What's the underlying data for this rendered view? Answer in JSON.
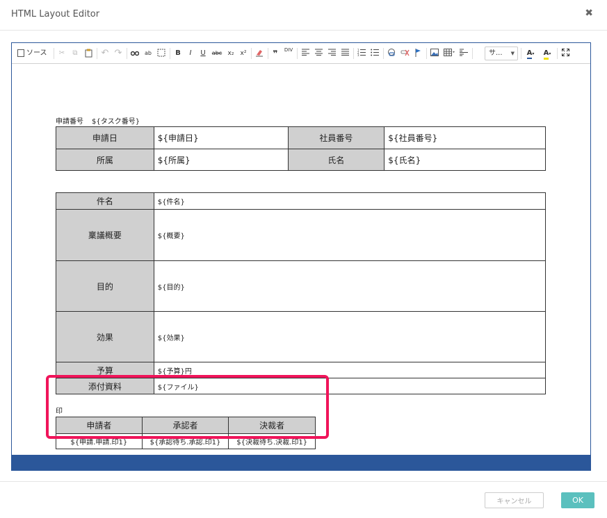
{
  "dialog": {
    "title": "HTML Layout Editor",
    "close_glyph": "✖"
  },
  "toolbar": {
    "source_label": "ソース",
    "style_select": "サ...",
    "icons": [
      "source-icon",
      "cut-icon",
      "copy-icon",
      "paste-icon",
      "undo-icon",
      "redo-icon",
      "find-icon",
      "replace-icon",
      "select-all-icon",
      "bold-icon",
      "italic-icon",
      "underline-icon",
      "strikethrough-icon",
      "subscript-icon",
      "superscript-icon",
      "remove-format-icon",
      "blockquote-icon",
      "div-icon",
      "align-left-icon",
      "align-center-icon",
      "align-right-icon",
      "align-justify-icon",
      "numbered-list-icon",
      "bulleted-list-icon",
      "link-icon",
      "unlink-icon",
      "anchor-icon",
      "image-icon",
      "table-icon",
      "horizontal-line-icon",
      "text-color-icon",
      "bg-color-icon",
      "maximize-icon"
    ],
    "glyphs": {
      "bold": "B",
      "italic": "I",
      "underline": "U",
      "strike": "abc",
      "sub": "x₂",
      "sup": "x²",
      "quote": "❞",
      "text_color": "A",
      "bg_color": "A"
    }
  },
  "document": {
    "app_number_label": "申請番号",
    "app_number_value": "${タスク番号}",
    "info_table": {
      "rows": [
        {
          "h1": "申請日",
          "v1": "${申請日}",
          "h2": "社員番号",
          "v2": "${社員番号}"
        },
        {
          "h1": "所属",
          "v1": "${所属}",
          "h2": "氏名",
          "v2": "${氏名}"
        }
      ]
    },
    "detail_table": {
      "rows": [
        {
          "h": "件名",
          "v": "${件名}"
        },
        {
          "h": "稟議概要",
          "v": "${概要}"
        },
        {
          "h": "目的",
          "v": "${目的}"
        },
        {
          "h": "効果",
          "v": "${効果}"
        },
        {
          "h": "予算",
          "v": "${予算}円"
        },
        {
          "h": "添付資料",
          "v": "${ファイル}"
        }
      ]
    },
    "stamp_label": "印",
    "stamp_table": {
      "headers": [
        "申請者",
        "承認者",
        "決裁者"
      ],
      "values": [
        "${申請.申請.印1}",
        "${承認待ち.承認.印1}",
        "${決裁待ち.決裁.印1}"
      ]
    }
  },
  "footer": {
    "cancel_label": "キャンセル",
    "ok_label": "OK"
  },
  "colors": {
    "accent": "#2b579a",
    "highlight": "#f0145a",
    "ok_button": "#5bc0be",
    "header_cell": "#d0d0d0"
  }
}
